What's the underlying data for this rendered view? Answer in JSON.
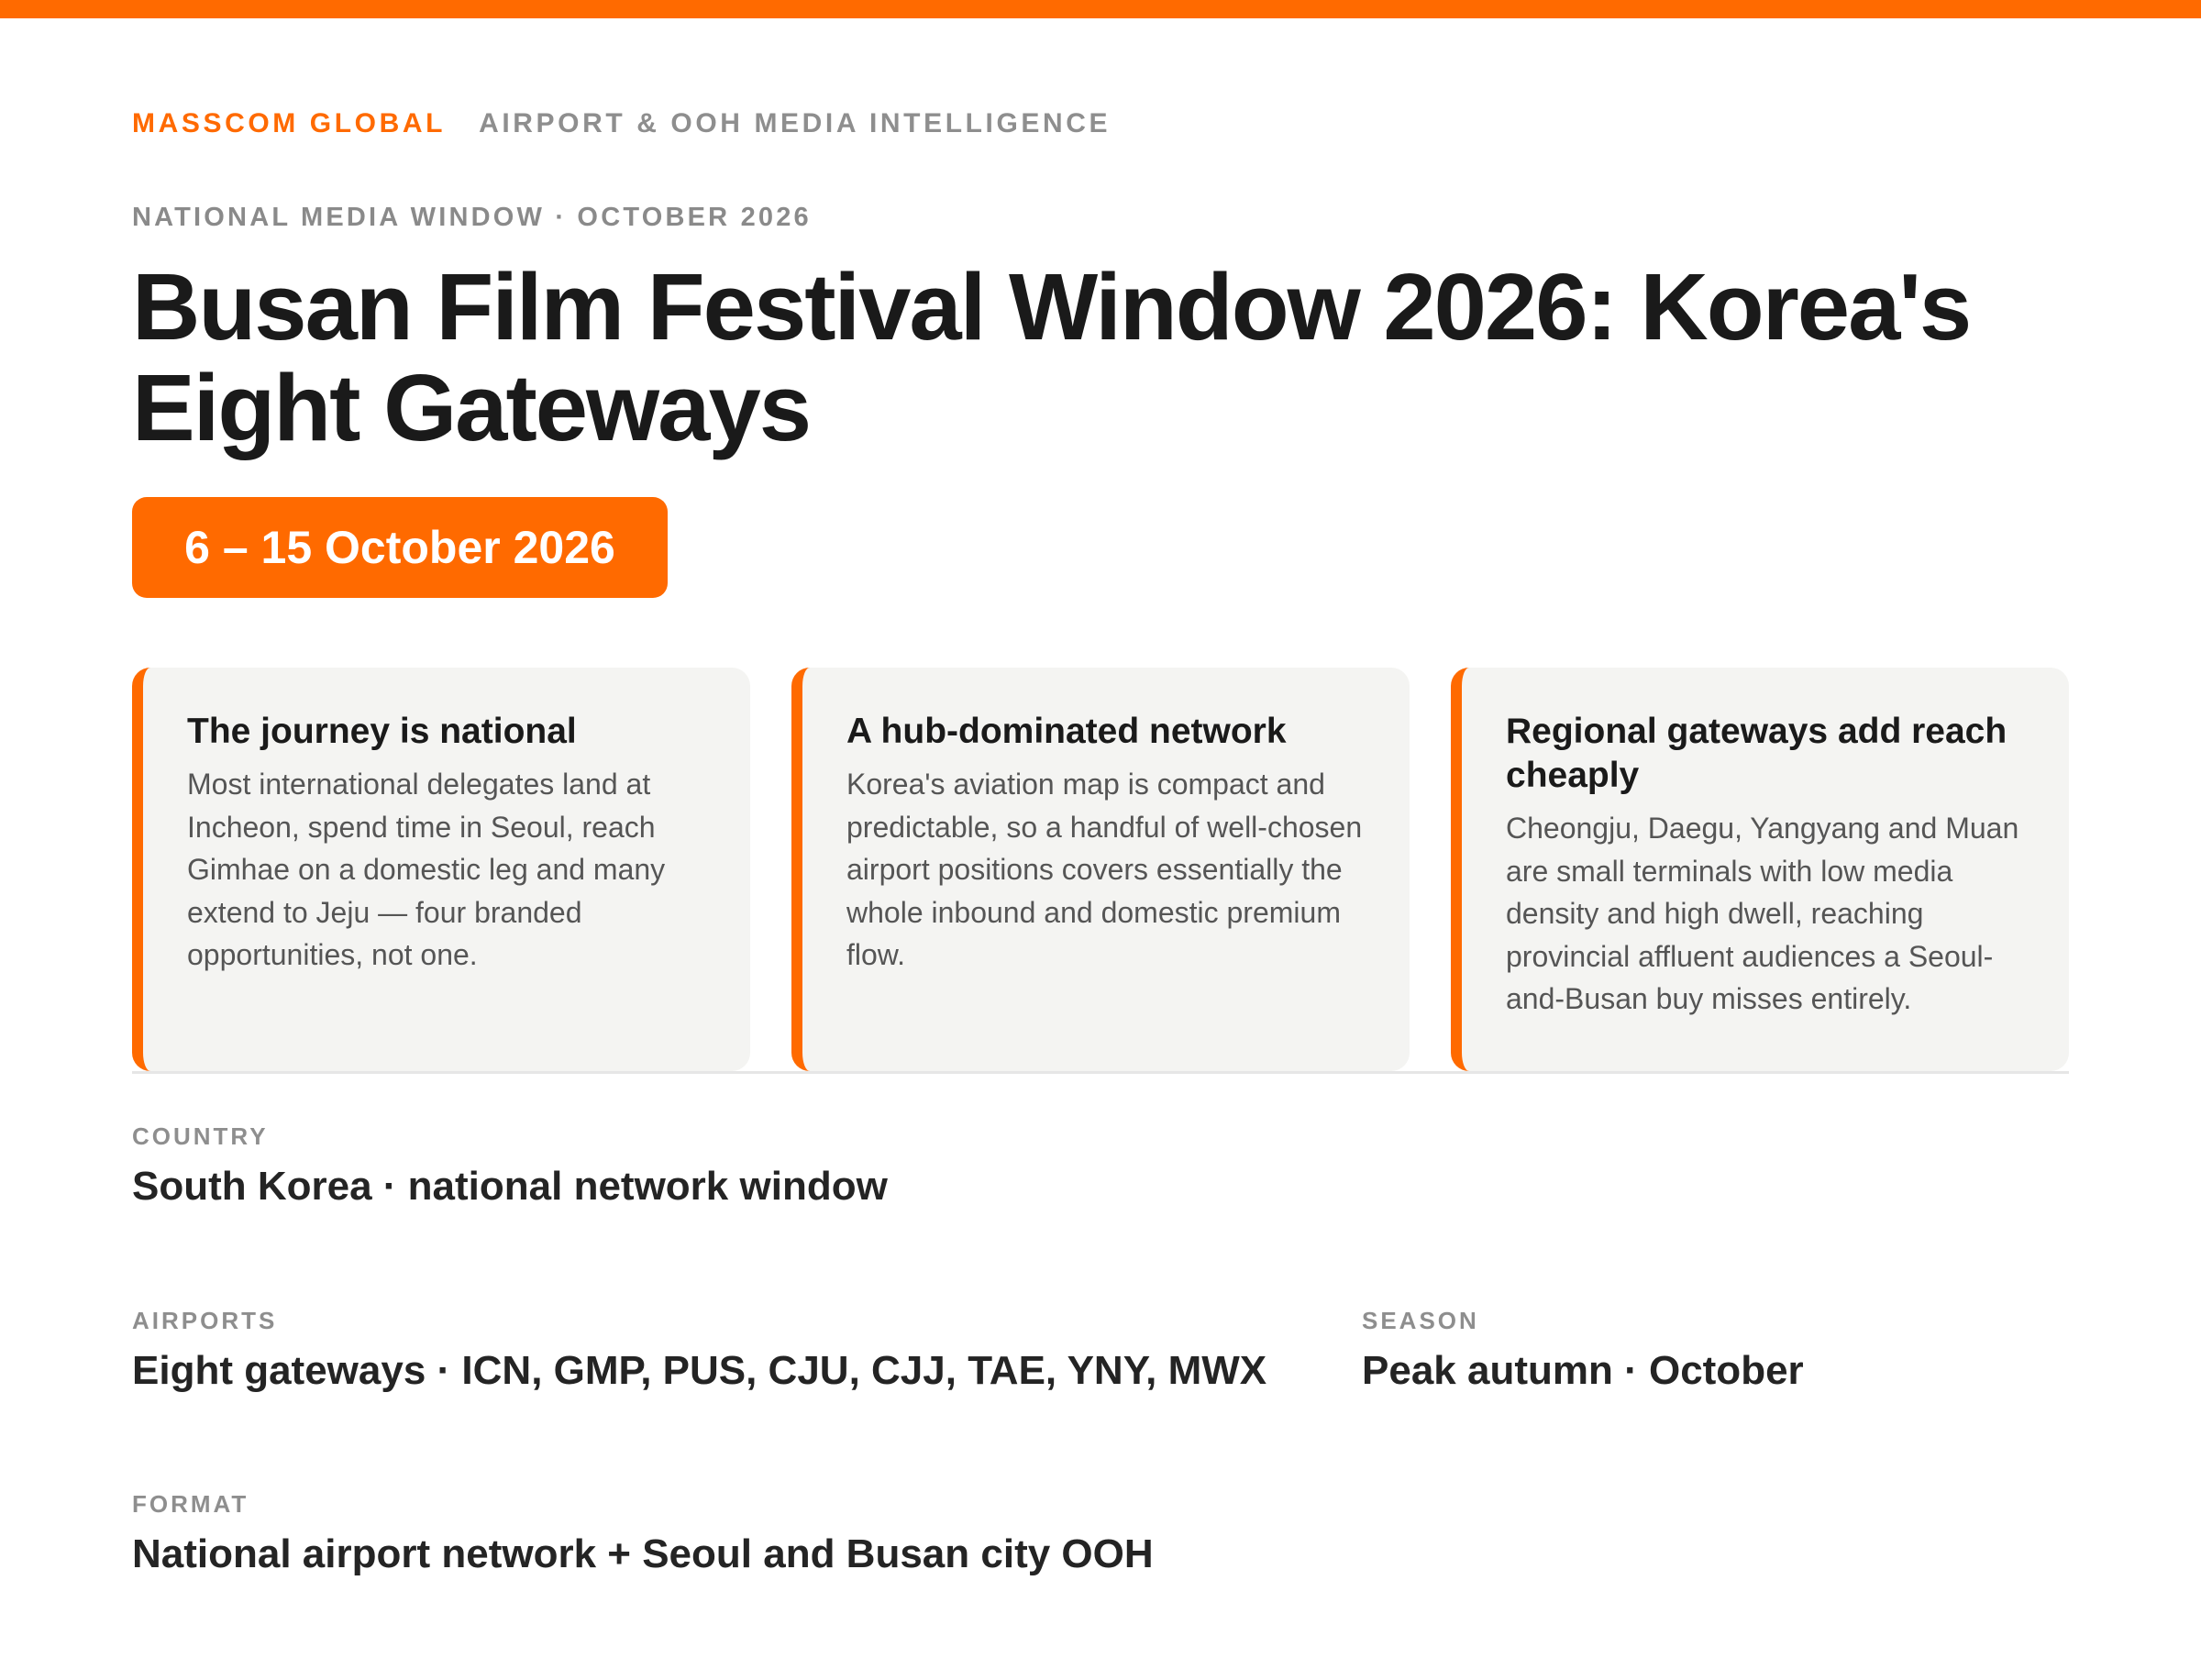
{
  "brand": {
    "name": "MASSCOM GLOBAL",
    "tagline": "AIRPORT & OOH MEDIA INTELLIGENCE"
  },
  "eyebrow": "NATIONAL MEDIA WINDOW · OCTOBER 2026",
  "title": "Busan Film Festival Window 2026: Korea's Eight Gateways",
  "date_range": "6 – 15 October 2026",
  "cards": [
    {
      "title": "The journey is national",
      "body": "Most international delegates land at Incheon, spend time in Seoul, reach Gimhae on a domestic leg and many extend to Jeju — four branded opportunities, not one."
    },
    {
      "title": "A hub-dominated network",
      "body": "Korea's aviation map is compact and predictable, so a handful of well-chosen airport positions covers essentially the whole inbound and domestic premium flow."
    },
    {
      "title": "Regional gateways add reach cheaply",
      "body": "Cheongju, Daegu, Yangyang and Muan are small terminals with low media density and high dwell, reaching provincial affluent audiences a Seoul-and-Busan buy misses entirely."
    }
  ],
  "details": {
    "country": {
      "label": "COUNTRY",
      "value": "South Korea · national network window"
    },
    "airports": {
      "label": "AIRPORTS",
      "value": "Eight gateways · ICN, GMP, PUS, CJU, CJJ, TAE, YNY, MWX"
    },
    "season": {
      "label": "SEASON",
      "value": "Peak autumn · October"
    },
    "format": {
      "label": "FORMAT",
      "value": "National airport network + Seoul and Busan city OOH"
    }
  },
  "colors": {
    "accent": "#ff6a00",
    "card_background": "#f4f4f2",
    "muted_text": "#8e8e8e"
  }
}
